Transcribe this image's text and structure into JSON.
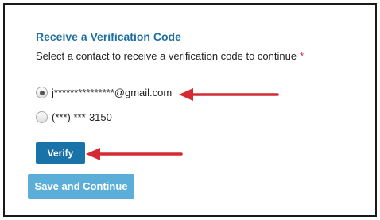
{
  "form": {
    "title": "Receive a Verification Code",
    "instruction": "Select a contact to receive a verification code to continue",
    "required_marker": "*",
    "options": [
      {
        "label": "j***************@gmail.com",
        "selected": true
      },
      {
        "label": "(***) ***-3150",
        "selected": false
      }
    ],
    "verify_label": "Verify",
    "save_label": "Save and Continue"
  },
  "colors": {
    "title": "#1f6f9e",
    "required": "#d9293a",
    "verify_button": "#1a73a8",
    "save_button": "#5aaed7",
    "arrow": "#d42a32"
  }
}
